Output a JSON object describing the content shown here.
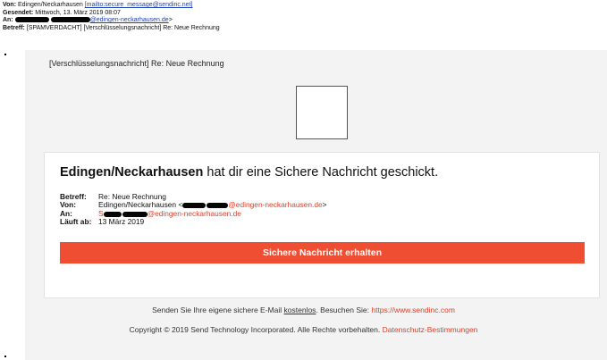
{
  "email_header": {
    "from_label": "Von:",
    "from_name": "Edingen/Neckarhausen",
    "from_link": "[mailto:secure_message@sendinc.net]",
    "sent_label": "Gesendet:",
    "sent_value": "Mittwoch, 13. März 2019 08:07",
    "to_label": "An:",
    "to_domain": "@edingen-neckarhausen.de",
    "to_suffix": ">",
    "subject_label": "Betreff:",
    "subject_value": "[SPAMVERDACHT] [Verschlüsselungsnachricht] Re: Neue Rechnung"
  },
  "body": {
    "subject_line": "[Verschlüsselungsnachricht] Re: Neue Rechnung"
  },
  "card": {
    "sender": "Edingen/Neckarhausen",
    "title_rest": "hat dir eine Sichere Nachricht geschickt.",
    "fields": {
      "betreff_label": "Betreff:",
      "betreff_value": "Re: Neue Rechnung",
      "von_label": "Von:",
      "von_name": "Edingen/Neckarhausen <",
      "von_domain": "@edingen-neckarhausen.de",
      "von_suffix": ">",
      "an_label": "An:",
      "an_prefix": "S",
      "an_domain": "@edingen-neckarhausen.de",
      "expires_label": "Läuft ab:",
      "expires_value": "13 März 2019"
    },
    "button_label": "Sichere Nachricht erhalten"
  },
  "footer": {
    "line1_prefix": "Senden Sie Ihre eigene sichere E-Mail",
    "line1_free": "kostenlos",
    "line1_mid": ". Besuchen Sie:",
    "line1_link": "https://www.sendinc.com",
    "line2_text": "Copyright © 2019 Send Technology Incorporated. Alle Rechte vorbehalten.",
    "line2_link": "Datenschutz-Bestimmungen"
  },
  "colors": {
    "accent_red": "#ef4e32",
    "link_red": "#e0402a",
    "link_blue": "#1f3fb5"
  }
}
